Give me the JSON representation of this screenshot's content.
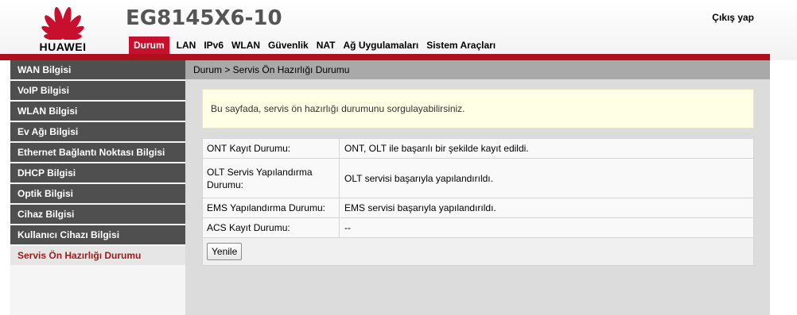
{
  "header": {
    "brand": "HUAWEI",
    "product": "EG8145X6-10",
    "logout_label": "Çıkış yap",
    "brand_color": "#c8102e"
  },
  "nav": {
    "items": [
      {
        "label": "Durum",
        "active": true
      },
      {
        "label": "LAN"
      },
      {
        "label": "IPv6"
      },
      {
        "label": "WLAN"
      },
      {
        "label": "Güvenlik"
      },
      {
        "label": "NAT"
      },
      {
        "label": "Ağ Uygulamaları"
      },
      {
        "label": "Sistem Araçları"
      }
    ]
  },
  "sidebar": {
    "items": [
      {
        "label": "WAN Bilgisi"
      },
      {
        "label": "VoIP Bilgisi"
      },
      {
        "label": "WLAN Bilgisi"
      },
      {
        "label": "Ev Ağı Bilgisi"
      },
      {
        "label": "Ethernet Bağlantı Noktası Bilgisi"
      },
      {
        "label": "DHCP Bilgisi"
      },
      {
        "label": "Optik Bilgisi"
      },
      {
        "label": "Cihaz Bilgisi"
      },
      {
        "label": "Kullanıcı Cihazı Bilgisi"
      },
      {
        "label": "Servis Ön Hazırlığı Durumu",
        "active": true
      }
    ]
  },
  "main": {
    "breadcrumb": "Durum > Servis Ön Hazırlığı Durumu",
    "notice": "Bu sayfada, servis ön hazırlığı durumunu sorgulayabilirsiniz.",
    "rows": [
      {
        "label": "ONT Kayıt Durumu:",
        "value": "ONT, OLT ile başarılı bir şekilde kayıt edildi."
      },
      {
        "label": "OLT Servis Yapılandırma Durumu:",
        "value": "OLT servisi başarıyla yapılandırıldı."
      },
      {
        "label": "EMS Yapılandırma Durumu:",
        "value": "EMS servisi başarıyla yapılandırıldı."
      },
      {
        "label": "ACS Kayıt Durumu:",
        "value": "--"
      }
    ],
    "refresh_label": "Yenile"
  }
}
